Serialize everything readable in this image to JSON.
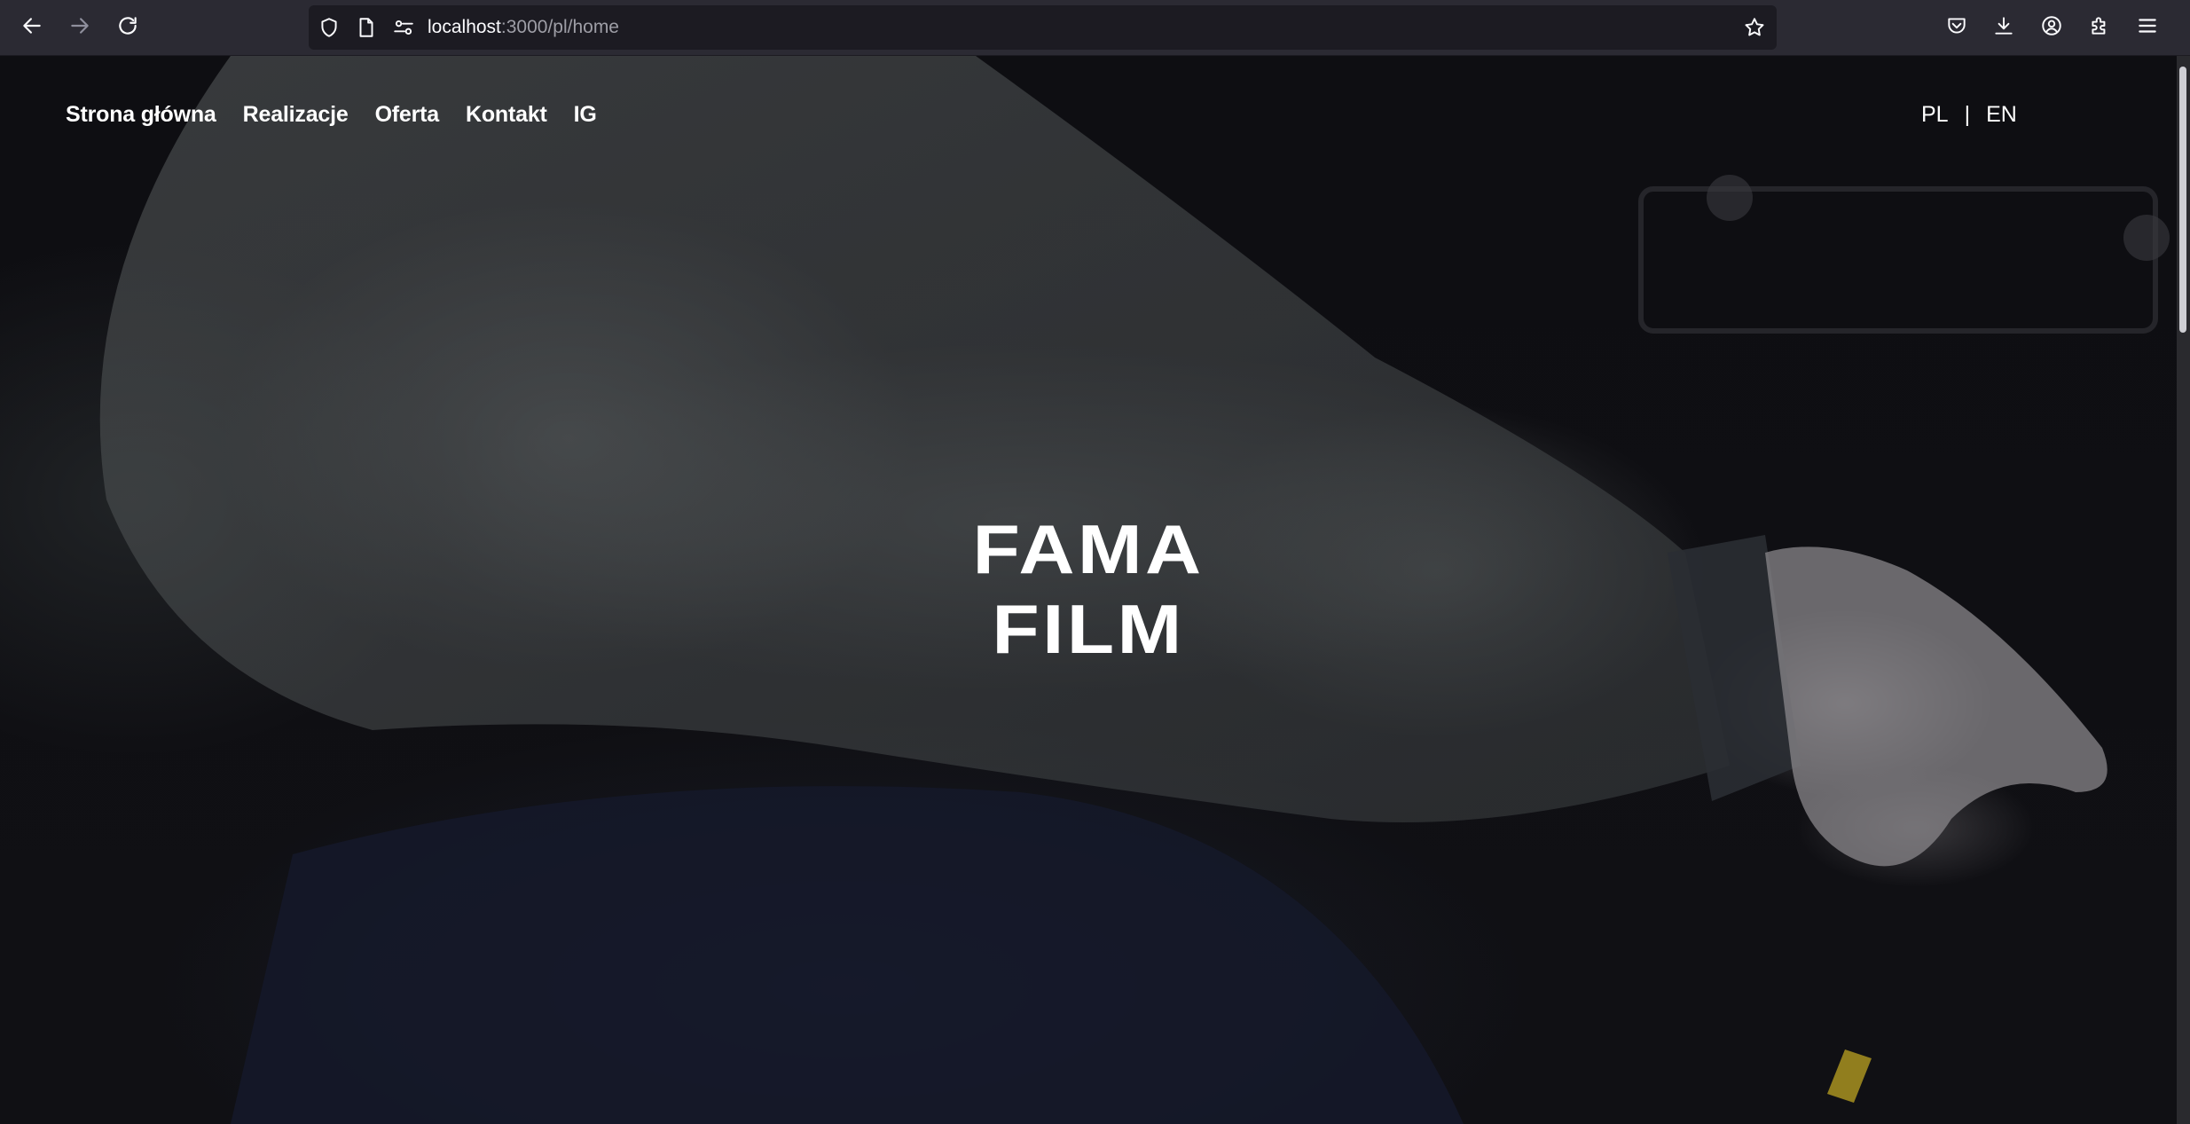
{
  "browser": {
    "url_host": "localhost",
    "url_path": ":3000/pl/home",
    "icons": {
      "back": "arrow-left-icon",
      "forward": "arrow-right-icon",
      "reload": "reload-icon",
      "shield": "shield-icon",
      "page": "page-icon",
      "permissions": "permissions-icon",
      "bookmark": "star-icon",
      "pocket": "pocket-icon",
      "downloads": "download-icon",
      "account": "account-icon",
      "extensions": "puzzle-icon",
      "menu": "hamburger-menu-icon"
    }
  },
  "nav": {
    "items": [
      {
        "label": "Strona główna"
      },
      {
        "label": "Realizacje"
      },
      {
        "label": "Oferta"
      },
      {
        "label": "Kontakt"
      },
      {
        "label": "IG"
      }
    ]
  },
  "lang": {
    "pl": "PL",
    "separator": "|",
    "en": "EN"
  },
  "hero": {
    "line1": "FAMA",
    "line2": "FILM"
  },
  "colors": {
    "toolbar_bg": "#2b2a33",
    "urlbar_bg": "#1c1b22",
    "text": "#ffffff"
  }
}
